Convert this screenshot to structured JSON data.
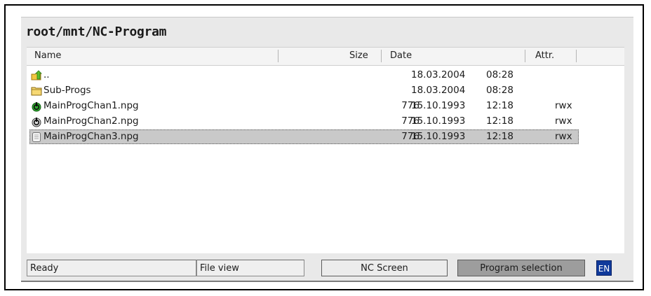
{
  "path": "root/mnt/NC-Program",
  "columns": {
    "name": "Name",
    "size": "Size",
    "date": "Date",
    "attr": "Attr."
  },
  "rows": [
    {
      "icon": "folder-up-icon",
      "name": "..",
      "size": "",
      "date": "18.03.2004",
      "time": "08:28",
      "attr": ""
    },
    {
      "icon": "folder-icon",
      "name": "Sub-Progs",
      "size": "",
      "date": "18.03.2004",
      "time": "08:28",
      "attr": ""
    },
    {
      "icon": "power-green-icon",
      "name": "MainProgChan1.npg",
      "size": "776",
      "date": "15.10.1993",
      "time": "12:18",
      "attr": "rwx"
    },
    {
      "icon": "power-icon",
      "name": "MainProgChan2.npg",
      "size": "776",
      "date": "15.10.1993",
      "time": "12:18",
      "attr": "rwx"
    },
    {
      "icon": "document-icon",
      "name": "MainProgChan3.npg",
      "size": "776",
      "date": "15.10.1993",
      "time": "12:18",
      "attr": "rwx",
      "selected": true
    }
  ],
  "status": {
    "ready": "Ready",
    "view": "File view",
    "nc_screen": "NC Screen",
    "program_selection": "Program selection",
    "language": "EN"
  },
  "colors": {
    "selection_bg": "#c9c9c9",
    "program_selection_bg": "#9d9d9d",
    "nc_screen_bg": "#ececec",
    "language_bg": "#103a9b",
    "power_green": "#2ea82e"
  }
}
